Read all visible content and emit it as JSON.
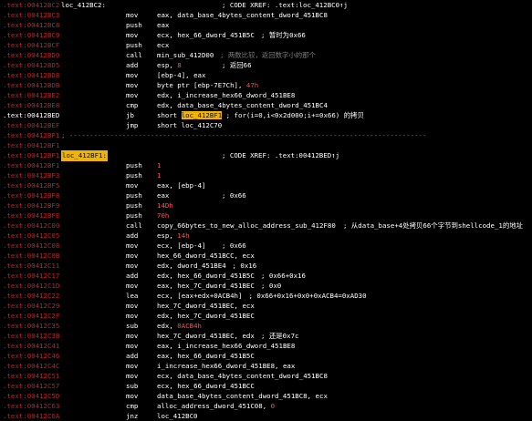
{
  "lines": [
    {
      "addr": ".text:0041 2BC2",
      "label": "loc_412BC2:",
      "xref": "; CODE XREF: .text:loc_412BC0↑j"
    },
    {
      "addr": ".text:0041 2BC3",
      "mnem": "mov",
      "ops": "eax, data_base_4bytes_content_dword_451BC8"
    },
    {
      "addr": ".text:0041 2BC8",
      "mnem": "push",
      "ops": "eax"
    },
    {
      "addr": ".text:0041 2BC9",
      "mnem": "mov",
      "ops": "ecx, hex_66_dword_451B5C",
      "cmt": "; 暂时为0x66"
    },
    {
      "addr": ".text:0041 2BCF",
      "mnem": "push",
      "ops": "ecx"
    },
    {
      "addr": ".text:0041 2BD0",
      "mnem": "call",
      "ops": "min_sub_412D00",
      "cmt": "; 两数比较，返回数字小的那个",
      "cmt_dim": true
    },
    {
      "addr": ".text:0041 2BD5",
      "mnem": "add",
      "ops": "esp, 8",
      "cmt": "; 返回66"
    },
    {
      "addr": ".text:0041 2BD8",
      "mnem": "mov",
      "ops": "[ebp-4], eax"
    },
    {
      "addr": ".text:0041 2BDB",
      "mnem": "mov",
      "ops": "byte ptr [ebp-7E7Ch], 47h"
    },
    {
      "addr": ".text:0041 2BE2",
      "mnem": "mov",
      "ops": "edx, i_increase_hex66_dword_451BE8"
    },
    {
      "addr": ".text:0041 2BE8",
      "mnem": "cmp",
      "ops": "edx, data_base_4bytes_content_dword_451BC4"
    },
    {
      "addr": ".text:00412BED",
      "addr_hl": true,
      "mnem": "jb",
      "ops_pre": "short ",
      "ops_hl": "loc_412BF1",
      "ops_post": " ; for(i=0,i<0x2d000;i+=0x66) 的拷贝"
    },
    {
      "addr": ".text:0041 2BEF",
      "mnem": "jmp",
      "ops": "short loc_412C70"
    },
    {
      "addr": ".text:0041 2BF1",
      "sep": true
    },
    {
      "addr": ".text:0041 2BF1",
      "blank": true
    },
    {
      "addr": ".text:0041 2BF1",
      "label": "loc_412BF1:",
      "label_boxed": true,
      "xref": "; CODE XREF: .text:00412BED↑j"
    },
    {
      "addr": ".text:0041 2BF1",
      "mnem": "push",
      "ops": "1"
    },
    {
      "addr": ".text:0041 2BF3",
      "mnem": "push",
      "ops": "1"
    },
    {
      "addr": ".text:0041 2BF5",
      "mnem": "mov",
      "ops": "eax, [ebp-4]"
    },
    {
      "addr": ".text:0041 2BF8",
      "mnem": "push",
      "ops": "eax",
      "cmt": "; 0x66"
    },
    {
      "addr": ".text:0041 2BF9",
      "mnem": "push",
      "ops": "14Dh"
    },
    {
      "addr": ".text:0041 2BFE",
      "mnem": "push",
      "ops": "70h"
    },
    {
      "addr": ".text:0041 2C00",
      "mnem": "call",
      "ops": "copy_66bytes_to_new_alloc_address_sub_412F80",
      "cmt": "; 从data_base+4处拷贝66个字节到shellcode_1的地址"
    },
    {
      "addr": ".text:0041 2C05",
      "mnem": "add",
      "ops": "esp, 14h"
    },
    {
      "addr": ".text:0041 2C08",
      "mnem": "mov",
      "ops": "ecx, [ebp-4]",
      "cmt": "; 0x66"
    },
    {
      "addr": ".text:0041 2C0B",
      "mnem": "mov",
      "ops": "hex_66_dword_451BCC, ecx"
    },
    {
      "addr": ".text:0041 2C11",
      "mnem": "mov",
      "ops": "edx, dword_451BE4",
      "cmt": "; 0x16"
    },
    {
      "addr": ".text:0041 2C17",
      "mnem": "add",
      "ops": "edx, hex_66_dword_451B5C",
      "cmt": "; 0x66+0x16"
    },
    {
      "addr": ".text:0041 2C1D",
      "mnem": "mov",
      "ops": "eax, hex_7C_dword_451BEC",
      "cmt": "; 0x0"
    },
    {
      "addr": ".text:0041 2C22",
      "mnem": "lea",
      "ops": "ecx, [eax+edx+0ACB4h]",
      "cmt": "; 0x66+0x16+0x0+0xACB4=0xAD30"
    },
    {
      "addr": ".text:0041 2C29",
      "mnem": "mov",
      "ops": "hex_7C_dword_451BEC, ecx"
    },
    {
      "addr": ".text:0041 2C2F",
      "mnem": "mov",
      "ops": "edx, hex_7C_dword_451BEC"
    },
    {
      "addr": ".text:0041 2C35",
      "mnem": "sub",
      "ops": "edx, 0ACB4h"
    },
    {
      "addr": ".text:0041 2C3B",
      "mnem": "mov",
      "ops": "hex_7C_dword_451BEC, edx",
      "cmt": "; 还是0x7c"
    },
    {
      "addr": ".text:0041 2C41",
      "mnem": "mov",
      "ops": "eax, i_increase_hex66_dword_451BE8"
    },
    {
      "addr": ".text:0041 2C46",
      "mnem": "add",
      "ops": "eax, hex_66_dword_451B5C"
    },
    {
      "addr": ".text:0041 2C4C",
      "mnem": "mov",
      "ops": "i_increase_hex66_dword_451BE8, eax"
    },
    {
      "addr": ".text:0041 2C51",
      "mnem": "mov",
      "ops": "ecx, data_base_4bytes_content_dword_451BC8"
    },
    {
      "addr": ".text:0041 2C57",
      "mnem": "sub",
      "ops": "ecx, hex_66_dword_451BCC"
    },
    {
      "addr": ".text:0041 2C5D",
      "mnem": "mov",
      "ops": "data_base_4bytes_content_dword_451BC8, ecx"
    },
    {
      "addr": ".text:0041 2C63",
      "mnem": "cmp",
      "ops": "alloc_address_dword_451C08, 0"
    },
    {
      "addr": ".text:0041 2C6A",
      "mnem": "jnz",
      "ops": "loc_412BC0"
    }
  ]
}
